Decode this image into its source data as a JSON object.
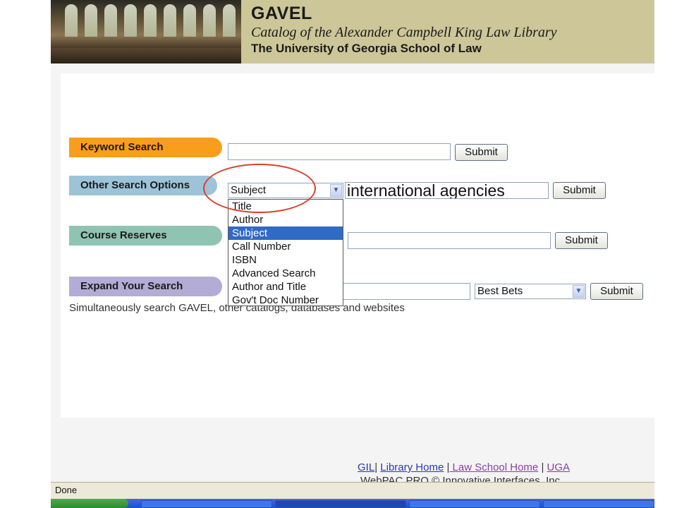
{
  "header": {
    "title": "GAVEL",
    "subtitle": "Catalog of the Alexander Campbell King Law Library",
    "institution": "The University of Georgia School of Law"
  },
  "keyword_search": {
    "label": "Keyword Search",
    "value": "",
    "submit_label": "Submit"
  },
  "other_search": {
    "label": "Other Search Options",
    "selected": "Subject",
    "value": "international agencies",
    "submit_label": "Submit",
    "options": [
      "Title",
      "Author",
      "Subject",
      "Call Number",
      "ISBN",
      "Advanced Search",
      "Author and Title",
      "Gov't Doc Number"
    ],
    "selected_index": 2
  },
  "course_reserves": {
    "label": "Course Reserves",
    "value": "",
    "submit_label": "Submit"
  },
  "expand_search": {
    "label": "Expand Your Search",
    "value": "",
    "scope_selected": "Best Bets",
    "submit_label": "Submit",
    "description": "Simultaneously search GAVEL, other catalogs, databases and websites"
  },
  "footer": {
    "links": [
      "GIL",
      "Library Home",
      " Law School Home",
      "UGA"
    ],
    "separator": "|",
    "copyright": "WebPAC PRO © Innovative Interfaces, Inc."
  },
  "status": {
    "text": "Done"
  },
  "colors": {
    "banner": "#cdc698",
    "keyword_pill": "#f99d1c",
    "other_pill": "#9dc3d8",
    "reserves_pill": "#8fc4b3",
    "expand_pill": "#b2acd6",
    "selection": "#316ac5",
    "annotation_ring": "#d9402a"
  },
  "icons": {
    "select_arrow": "chevron-down-icon"
  }
}
